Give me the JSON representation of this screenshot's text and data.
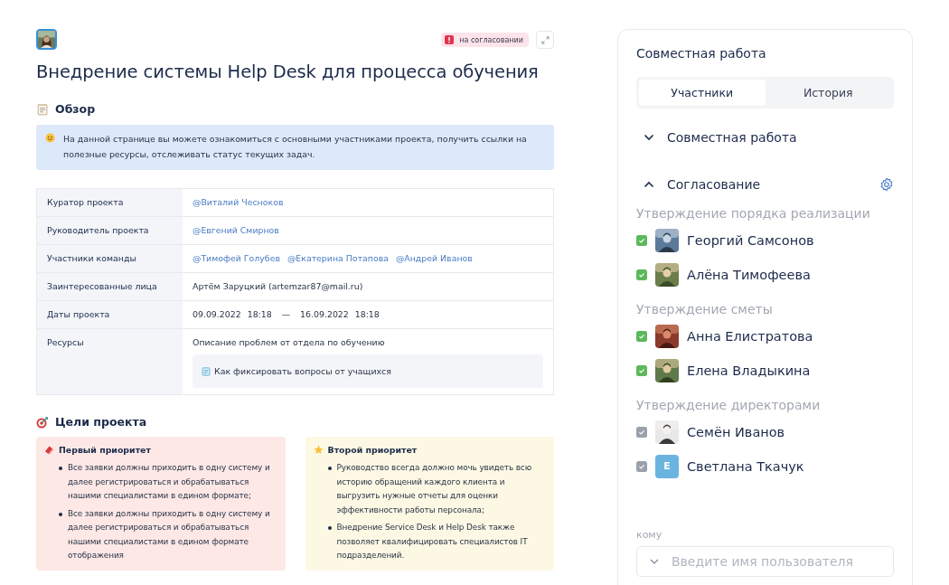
{
  "header": {
    "status_badge": "на согласовании"
  },
  "title": "Внедрение системы Help Desk для процесса обучения",
  "overview": {
    "heading": "Обзор",
    "note": "На данной странице вы можете ознакомиться с основными участниками проекта, получить ссылки на полезные ресурсы, отслеживать статус текущих задач."
  },
  "details": [
    {
      "label": "Куратор проекта",
      "kind": "mentions",
      "mentions": [
        "@Виталий Чесноков"
      ]
    },
    {
      "label": "Руководитель проекта",
      "kind": "mentions",
      "mentions": [
        "@Евгений Смирнов"
      ]
    },
    {
      "label": "Участники команды",
      "kind": "mentions",
      "mentions": [
        "@Тимофей Голубев",
        "@Екатерина Потапова",
        "@Андрей Иванов"
      ]
    },
    {
      "label": "Заинтересованные лица",
      "kind": "text",
      "text": "Артём Заруцкий (artemzar87@mail.ru)"
    },
    {
      "label": "Даты проекта",
      "kind": "dates",
      "start_date": "09.09.2022",
      "start_time": "18:18",
      "separator": "—",
      "end_date": "16.09.2022",
      "end_time": "18:18"
    },
    {
      "label": "Ресурсы",
      "kind": "resources",
      "text": "Описание проблем от отдела по обучению",
      "document": "Как фиксировать вопросы от учащихся"
    }
  ],
  "goals": {
    "heading": "Цели проекта",
    "cards": [
      {
        "kind": "first",
        "title": "Первый приоритет",
        "items": [
          "Все заявки должны приходить в одну систему и далее регистрироваться и обрабатываться нашими специалистами в едином формате;",
          "Все заявки должны приходить в одну систему и далее регистрироваться и обрабатываться нашими специалистами в едином формате отображения"
        ]
      },
      {
        "kind": "second",
        "title": "Второй приоритет",
        "items": [
          "Руководство всегда должно мочь увидеть всю историю обращений каждого клиента и выгрузить нужные отчеты для оценки эффективности работы персонала;",
          "Внедрение Service Desk и Help Desk также позволяет квалифицировать специалистов IT подразделений."
        ]
      }
    ]
  },
  "collaboration": {
    "title": "Совместная работа",
    "tabs": [
      {
        "label": "Участники",
        "selected": true
      },
      {
        "label": "История",
        "selected": false
      }
    ],
    "sections": [
      {
        "title": "Совместная работа",
        "expanded": false
      },
      {
        "title": "Согласование",
        "expanded": true
      }
    ],
    "groups": [
      {
        "title": "Утверждение порядка реализации",
        "people": [
          {
            "name": "Георгий Самсонов",
            "approved": true
          },
          {
            "name": "Алёна Тимофеева",
            "approved": true
          }
        ]
      },
      {
        "title": "Утверждение сметы",
        "people": [
          {
            "name": "Анна Елистратова",
            "approved": true
          },
          {
            "name": "Елена Владыкина",
            "approved": true
          }
        ]
      },
      {
        "title": "Утверждение директорами",
        "people": [
          {
            "name": "Семён Иванов",
            "approved": false
          },
          {
            "name": "Светлана Ткачук",
            "approved": false,
            "avatar": {
              "kind": "initial",
              "initial": "E"
            }
          }
        ]
      }
    ],
    "recipient": {
      "label": "кому",
      "placeholder": "Введите имя пользователя"
    }
  }
}
